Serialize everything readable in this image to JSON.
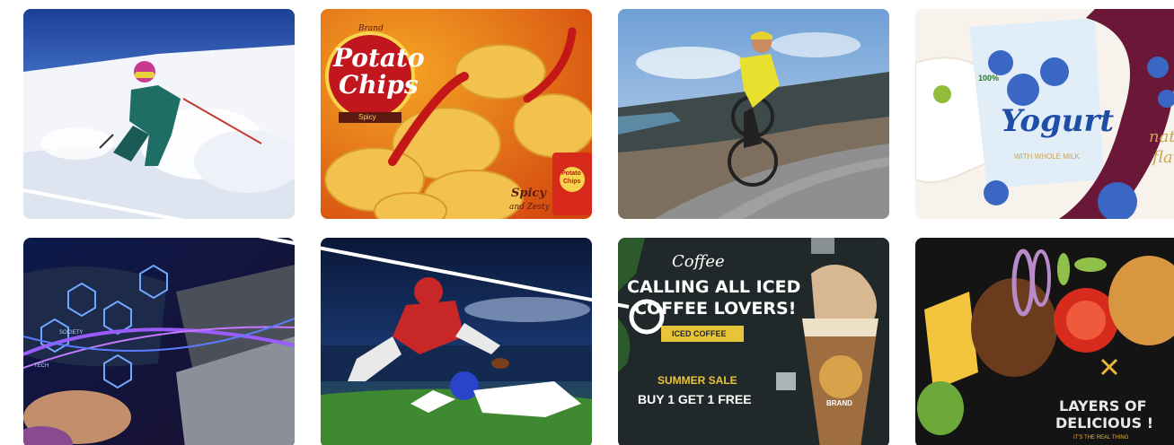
{
  "gallery": {
    "row1": [
      {
        "subject": "skier-photo"
      },
      {
        "subject": "potato-chips-ad",
        "brand": "Brand",
        "title_line1": "Potato",
        "title_line2": "Chips",
        "flavor": "Spicy",
        "tagline_line1": "Spicy",
        "tagline_line2": "and Zesty",
        "pack_text_line1": "Potato",
        "pack_text_line2": "Chips"
      },
      {
        "subject": "cyclist-photo"
      },
      {
        "subject": "yogurt-ad",
        "can_title": "Yogurt",
        "can_percent": "100%",
        "can_subtitle": "WITH WHOLE MILK",
        "side_line1": "natu",
        "side_line2": "flavo"
      }
    ],
    "row2": [
      {
        "subject": "technology-laptop-photo",
        "icon_labels": [
          "SOCIETY",
          "TECH"
        ]
      },
      {
        "subject": "american-football-photo"
      },
      {
        "subject": "iced-coffee-ad",
        "script_title": "Coffee",
        "headline_line1": "CALLING ALL ICED",
        "headline_line2": "COFFEE LOVERS!",
        "ribbon": "ICED COFFEE",
        "sale": "SUMMER SALE",
        "offer": "BUY 1 GET 1 FREE",
        "cup_label": "BRAND"
      },
      {
        "subject": "burger-ad",
        "headline_line1": "LAYERS OF",
        "headline_line2": "DELICIOUS !",
        "tagline": "IT'S THE REAL THING"
      }
    ]
  },
  "colors": {
    "accent_line": "#ffffff",
    "cursor_ring": "#ffffff"
  }
}
